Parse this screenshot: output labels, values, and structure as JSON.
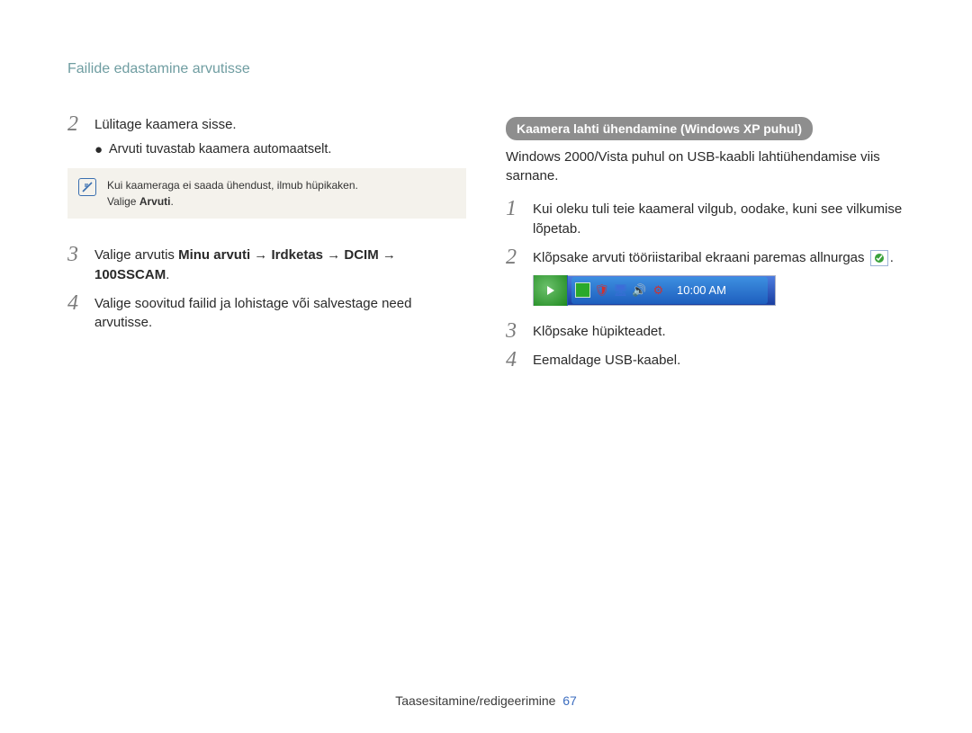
{
  "header": "Failide edastamine arvutisse",
  "left": {
    "step2": {
      "num": "2",
      "text": "Lülitage kaamera sisse."
    },
    "bullet": "Arvuti tuvastab kaamera automaatselt.",
    "note_line1": "Kui kaameraga ei saada ühendust, ilmub hüpikaken.",
    "note_line2_prefix": "Valige ",
    "note_line2_bold": "Arvuti",
    "step3": {
      "num": "3",
      "prefix": "Valige arvutis ",
      "p1": "Minu arvuti",
      "p2": "Irdketas",
      "p3": "DCIM",
      "p4": "100SSCAM"
    },
    "step4": {
      "num": "4",
      "text": "Valige soovitud failid ja lohistage või salvestage need arvutisse."
    }
  },
  "right": {
    "pill": "Kaamera lahti ühendamine (Windows XP puhul)",
    "intro": "Windows 2000/Vista puhul on USB-kaabli lahtiühendamise viis sarnane.",
    "step1": {
      "num": "1",
      "text": "Kui oleku tuli teie kaameral vilgub, oodake, kuni see vilkumise lõpetab."
    },
    "step2": {
      "num": "2",
      "text_a": "Klõpsake arvuti tööriistaribal ekraani paremas allnurgas",
      "text_b": "."
    },
    "tray_time": "10:00 AM",
    "step3": {
      "num": "3",
      "text": "Klõpsake hüpikteadet."
    },
    "step4": {
      "num": "4",
      "text": "Eemaldage USB-kaabel."
    }
  },
  "footer": {
    "section": "Taasesitamine/redigeerimine",
    "page": "67"
  },
  "arrow": "→"
}
